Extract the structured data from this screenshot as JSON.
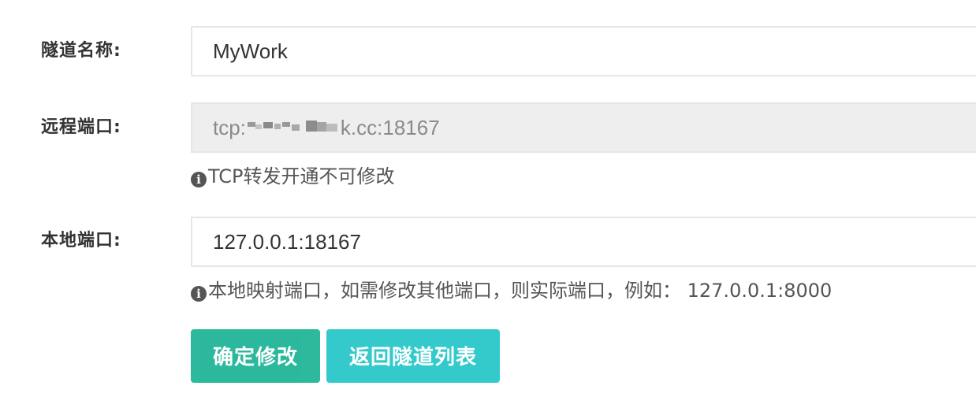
{
  "form": {
    "tunnel_name": {
      "label": "隧道名称:",
      "value": "MyWork"
    },
    "remote_port": {
      "label": "远程端口:",
      "value_prefix": "tcp:",
      "value_suffix": "k.cc:18167",
      "hint_icon": "info-icon",
      "hint": "TCP转发开通不可修改"
    },
    "local_port": {
      "label": "本地端口:",
      "value": "127.0.0.1:18167",
      "hint_icon": "info-icon",
      "hint": "本地映射端口，如需修改其他端口，则实际端口，例如： 127.0.0.1:8000"
    },
    "buttons": {
      "confirm": "确定修改",
      "back": "返回隧道列表"
    }
  },
  "colors": {
    "primary_button": "#1ab394",
    "info_button": "#23c6c8",
    "readonly_bg": "#eeeeee",
    "border": "#e5e6e7"
  }
}
